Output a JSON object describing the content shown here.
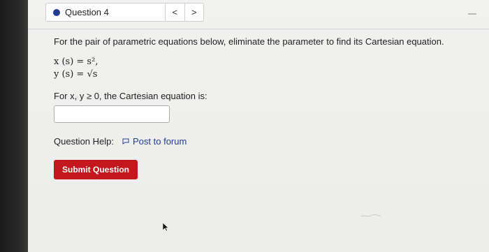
{
  "question_selector": {
    "label": "Question 4"
  },
  "nav": {
    "prev": "<",
    "next": ">"
  },
  "prompt": "For the pair of parametric equations below, eliminate the parameter to find its Cartesian equation.",
  "equations": {
    "line1": "x (s) = s², ",
    "line2": "y (s) = √s"
  },
  "condition": "For x, y ≥ 0, the Cartesian equation is:",
  "answer": {
    "value": ""
  },
  "help": {
    "label": "Question Help:",
    "forum_link": "Post to forum"
  },
  "submit_label": "Submit Question",
  "colors": {
    "accent": "#1f3b94",
    "submit": "#c4161c"
  }
}
